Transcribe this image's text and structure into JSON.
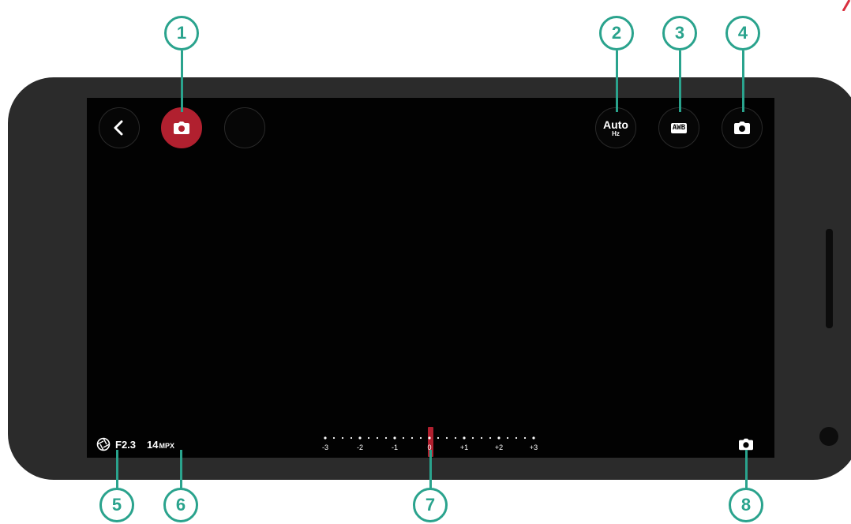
{
  "colors": {
    "callout_teal": "#2aa38d",
    "active_red": "#b1202f",
    "screen_bg": "#020202",
    "phone_body": "#2b2b2b"
  },
  "top_bar": {
    "back": {
      "icon": "chevron-left-icon"
    },
    "photo_mode": {
      "icon": "camera-icon",
      "active": true
    },
    "empty_slot": {
      "icon": ""
    },
    "antibanding": {
      "label": "Auto",
      "sub_label": "Hz"
    },
    "white_balance": {
      "label": "AWB"
    },
    "camera_switch": {
      "icon": "camera-icon"
    }
  },
  "status": {
    "aperture_icon": "aperture-icon",
    "aperture": "F2.3",
    "resolution_value": "14",
    "resolution_unit": "MPX",
    "bottom_icon": "camera-icon"
  },
  "exposure": {
    "labels": [
      "-3",
      "-2",
      "-1",
      "0",
      "+1",
      "+2",
      "+3"
    ],
    "current": "0"
  },
  "callouts": [
    "1",
    "2",
    "3",
    "4",
    "5",
    "6",
    "7",
    "8"
  ]
}
